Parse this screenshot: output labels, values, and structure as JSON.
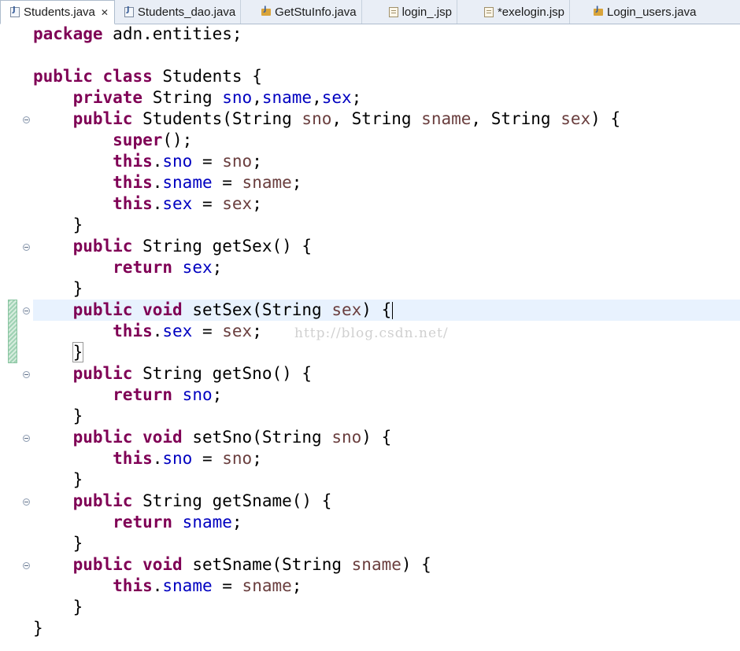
{
  "tabs": [
    {
      "label": "Students.java",
      "icon": "java-file-icon",
      "active": true,
      "close": "✕"
    },
    {
      "label": "Students_dao.java",
      "icon": "java-file-icon",
      "active": false
    },
    {
      "label": "GetStuInfo.java",
      "icon": "java-package-icon",
      "active": false
    },
    {
      "label": "login_.jsp",
      "icon": "jsp-file-icon",
      "active": false
    },
    {
      "label": "*exelogin.jsp",
      "icon": "jsp-file-icon",
      "active": false
    },
    {
      "label": "Login_users.java",
      "icon": "java-package-icon",
      "active": false
    }
  ],
  "code": {
    "kw_package": "package",
    "package_name": "adn.entities;",
    "kw_public": "public",
    "kw_class": "class",
    "class_name": "Students",
    "kw_private": "private",
    "kw_void": "void",
    "kw_super": "super",
    "kw_this": "this",
    "kw_return": "return",
    "type_string": "String",
    "sno": "sno",
    "sname": "sname",
    "sex": "sex",
    "m_getSex": "getSex",
    "m_setSex": "setSex",
    "m_getSno": "getSno",
    "m_setSno": "setSno",
    "m_getSname": "getSname",
    "m_setSname": "setSname",
    "open_brace": "{",
    "close_brace": "}"
  },
  "watermark": "http://blog.csdn.net/"
}
